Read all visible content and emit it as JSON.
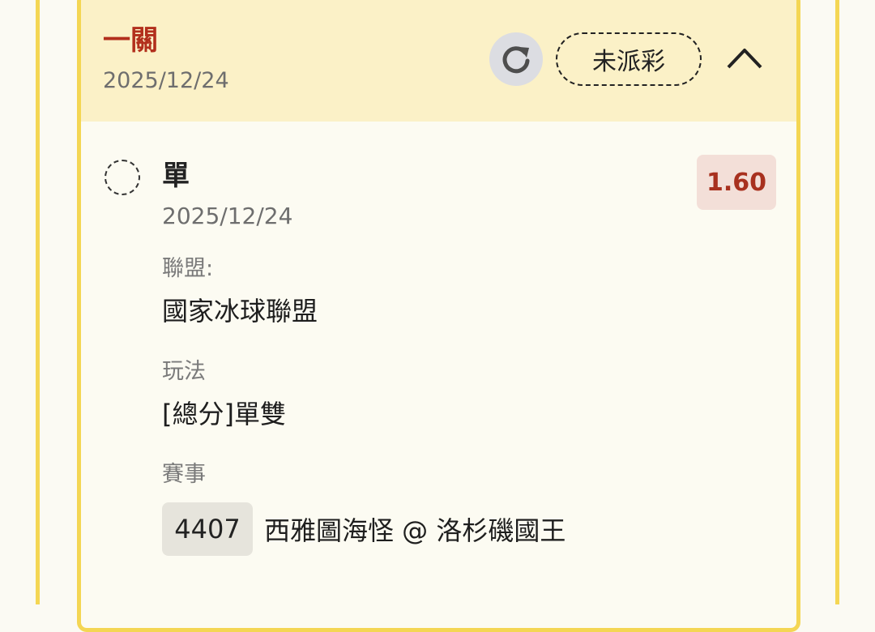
{
  "header": {
    "title": "一關",
    "date": "2025/12/24",
    "status": "未派彩"
  },
  "bet": {
    "selection": "單",
    "date": "2025/12/24",
    "odds": "1.60",
    "league_label": "聯盟:",
    "league_value": "國家冰球聯盟",
    "play_label": "玩法",
    "play_value": "[總分]單雙",
    "match_label": "賽事",
    "match_id": "4407",
    "match_name": "西雅圖海怪 @ 洛杉磯國王"
  },
  "colors": {
    "accent_border": "#f4d653",
    "header_bg": "#fbf1c7",
    "title_red": "#b22f1c",
    "odds_bg": "#f3dfd8"
  },
  "icons": {
    "refresh": "refresh-icon",
    "collapse": "chevron-up-icon",
    "select": "dashed-circle-icon"
  }
}
